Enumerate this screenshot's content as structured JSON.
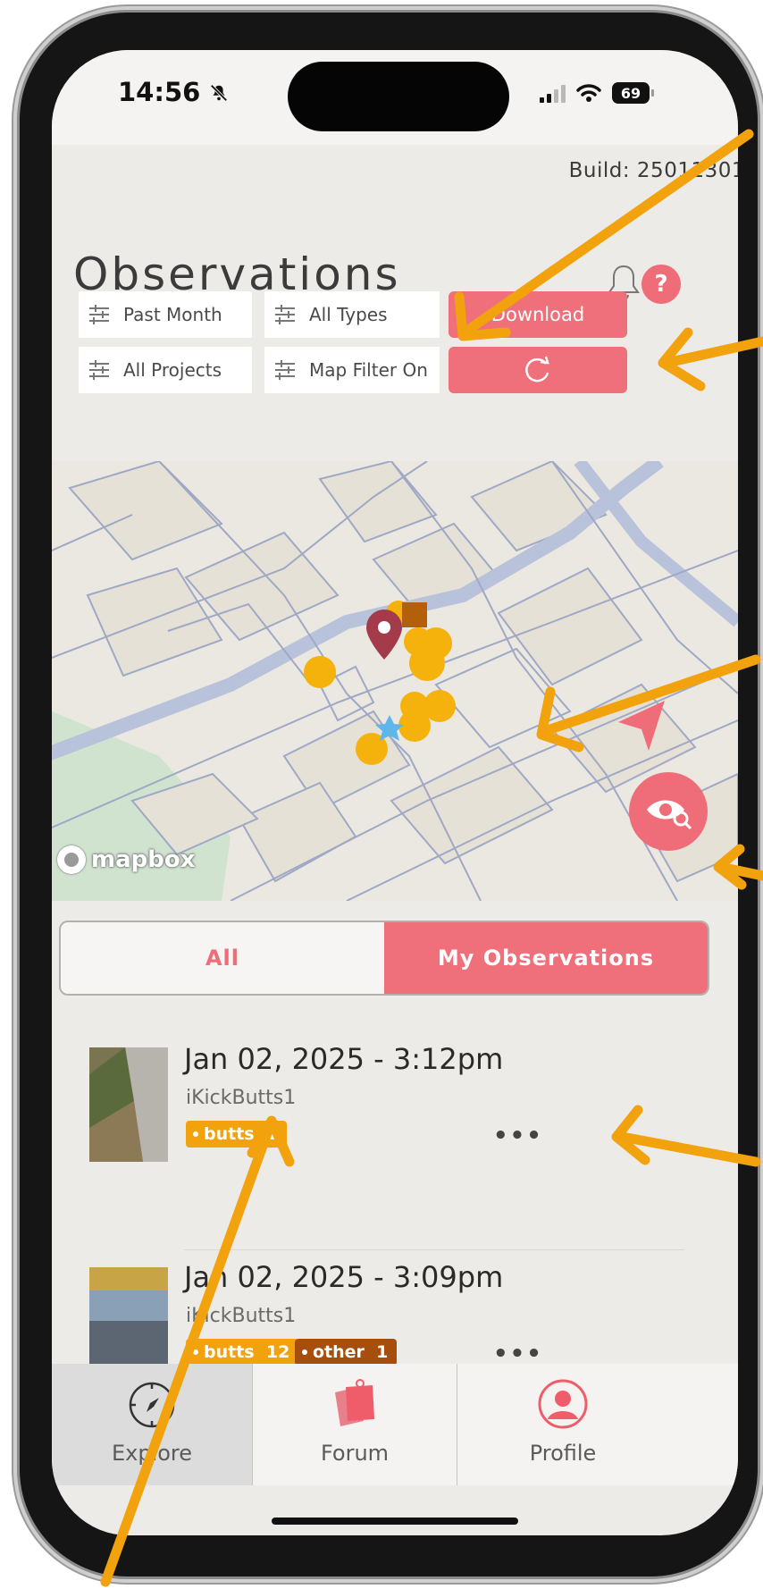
{
  "status_bar": {
    "time": "14:56",
    "battery": "69"
  },
  "header": {
    "build": "Build: 25011301",
    "title": "Observations",
    "help_label": "?"
  },
  "filters": {
    "time_range": "Past Month",
    "types": "All Types",
    "download": "Download",
    "projects": "All Projects",
    "map_filter": "Map Filter On"
  },
  "map": {
    "attribution": "mapbox"
  },
  "segment": {
    "all": "All",
    "mine": "My Observations",
    "selected": "My Observations"
  },
  "observations": [
    {
      "date": "Jan 02, 2025 - 3:12pm",
      "user": "iKickButts1",
      "tags": [
        {
          "label": "butts",
          "count": "1",
          "color": "#f2a20c"
        }
      ],
      "more": "•••"
    },
    {
      "date": "Jan 02, 2025 - 3:09pm",
      "user": "iKickButts1",
      "tags": [
        {
          "label": "butts",
          "count": "12",
          "color": "#f2a20c"
        },
        {
          "label": "other",
          "count": "1",
          "color": "#a54e0e"
        }
      ],
      "more": "•••"
    }
  ],
  "tabbar": {
    "explore": "Explore",
    "forum": "Forum",
    "profile": "Profile",
    "active": "Explore"
  },
  "colors": {
    "accent": "#ef6f7b",
    "annotation": "#f2a20c",
    "marker": "#f5b10c"
  }
}
